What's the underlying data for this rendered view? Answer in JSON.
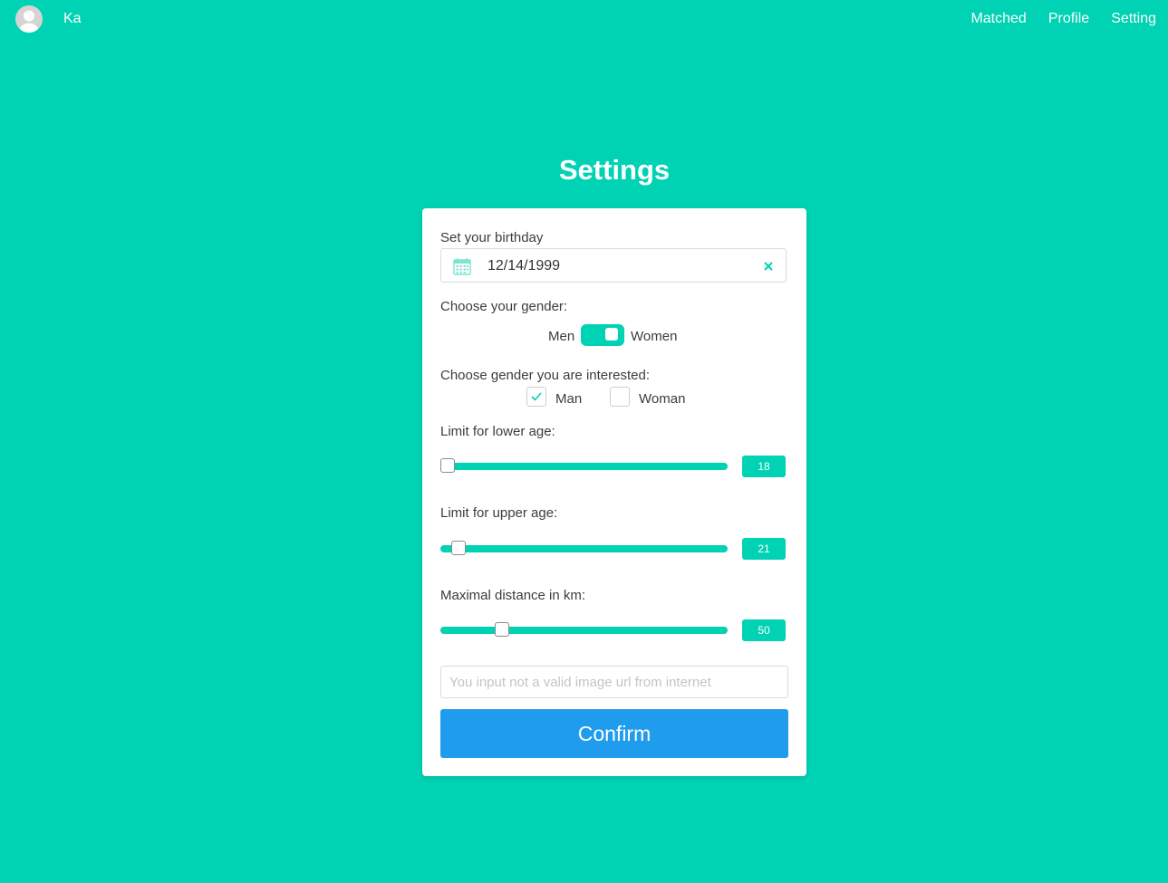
{
  "topbar": {
    "username": "Ka",
    "nav": [
      "Matched",
      "Profile",
      "Setting"
    ]
  },
  "page": {
    "title": "Settings"
  },
  "form": {
    "birthday_label": "Set your birthday",
    "birthday_value": "12/14/1999",
    "gender_label": "Choose your gender:",
    "gender_left": "Men",
    "gender_right": "Women",
    "gender_selected": "Women",
    "interest_label": "Choose gender you are interested:",
    "interest_options": [
      {
        "label": "Man",
        "checked": true
      },
      {
        "label": "Woman",
        "checked": false
      }
    ],
    "sliders": [
      {
        "label": "Limit for lower age:",
        "value": "18",
        "fraction": 0.0
      },
      {
        "label": "Limit for upper age:",
        "value": "21",
        "fraction": 0.04
      },
      {
        "label": "Maximal distance in km:",
        "value": "50",
        "fraction": 0.2
      }
    ],
    "url_placeholder": "You input not a valid image url from internet",
    "confirm_label": "Confirm"
  },
  "colors": {
    "background": "#00d2b4",
    "accent": "#00d2b4",
    "button": "#209cee"
  },
  "icons": {
    "avatar": "user-avatar-icon",
    "calendar": "calendar-icon",
    "clear": "close-icon",
    "check": "check-icon"
  }
}
